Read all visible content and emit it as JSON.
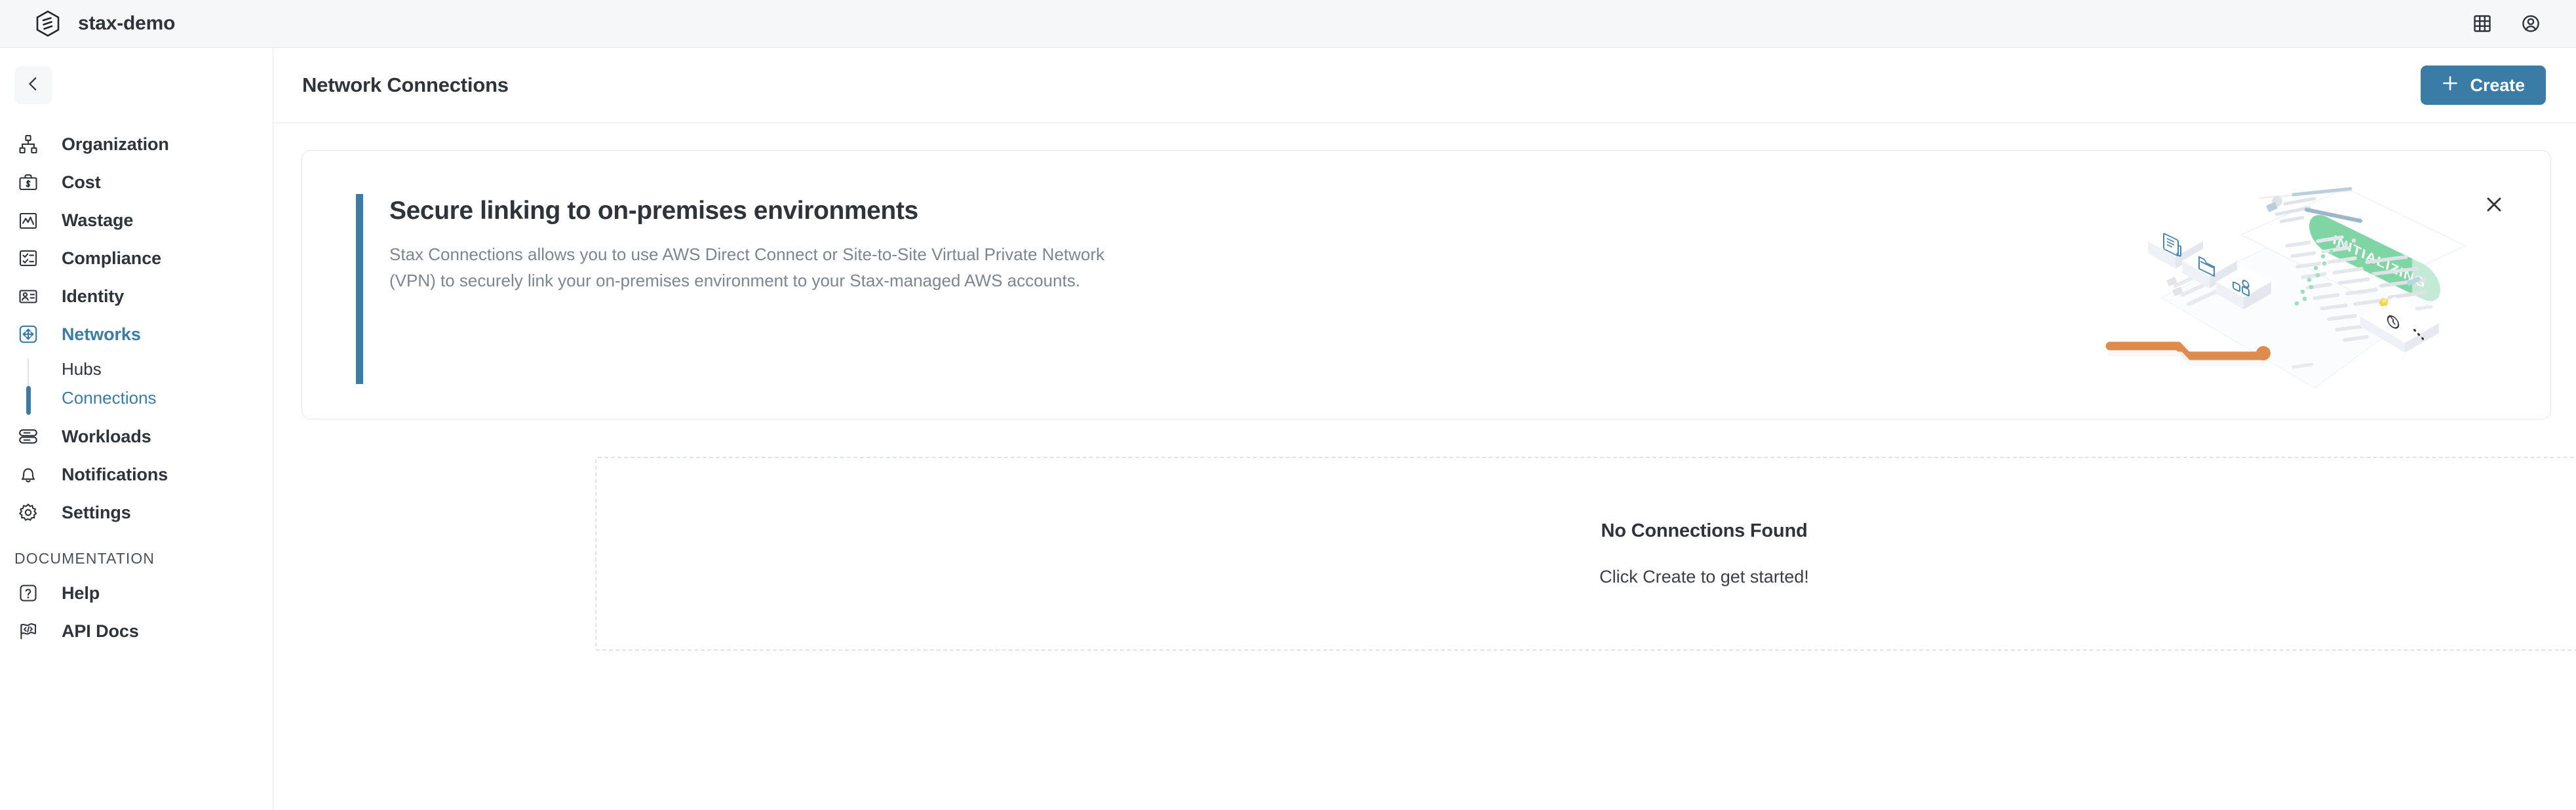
{
  "topbar": {
    "brand_name": "stax-demo",
    "logo_icon": "stax-hexagon-logo",
    "actions": [
      {
        "icon": "grid-apps-icon",
        "name": "apps-grid-button"
      },
      {
        "icon": "user-circle-icon",
        "name": "account-button"
      }
    ]
  },
  "sidebar": {
    "collapse_icon": "chevron-left-icon",
    "items": [
      {
        "label": "Organization",
        "icon": "org-chart-icon",
        "active": false
      },
      {
        "label": "Cost",
        "icon": "briefcase-dollar-icon",
        "active": false
      },
      {
        "label": "Wastage",
        "icon": "chart-line-box-icon",
        "active": false
      },
      {
        "label": "Compliance",
        "icon": "checklist-icon",
        "active": false
      },
      {
        "label": "Identity",
        "icon": "id-card-icon",
        "active": false
      },
      {
        "label": "Networks",
        "icon": "network-move-icon",
        "active": true
      }
    ],
    "subitems": [
      {
        "label": "Hubs",
        "active": false
      },
      {
        "label": "Connections",
        "active": true
      }
    ],
    "items_after": [
      {
        "label": "Workloads",
        "icon": "server-stack-icon",
        "active": false
      },
      {
        "label": "Notifications",
        "icon": "bell-icon",
        "active": false
      },
      {
        "label": "Settings",
        "icon": "gear-icon",
        "active": false
      }
    ],
    "section_title": "DOCUMENTATION",
    "doc_items": [
      {
        "label": "Help",
        "icon": "question-box-icon",
        "active": false
      },
      {
        "label": "API Docs",
        "icon": "flag-code-icon",
        "active": false
      }
    ]
  },
  "page": {
    "title": "Network Connections",
    "create_label": "Create",
    "create_icon": "plus-icon"
  },
  "banner": {
    "title": "Secure linking to on-premises environments",
    "description": "Stax Connections allows you to use AWS Direct Connect or Site-to-Site Virtual Private Network (VPN) to securely link your on-premises environment to your Stax-managed AWS accounts.",
    "close_icon": "close-x-icon",
    "illustration_label": "INITIALIZING",
    "illustration_name": "isometric-dashboard-illustration"
  },
  "empty_state": {
    "title": "No Connections Found",
    "subtitle": "Click Create to get started!"
  },
  "colors": {
    "accent": "#3a7ca5",
    "text": "#2f343b",
    "muted": "#7d858f",
    "topbar_bg": "#f6f7f9",
    "border": "#e6e8eb",
    "illustration_green": "#7fd6a4",
    "illustration_orange": "#e08b4e",
    "illustration_yellow": "#f5d44c"
  }
}
